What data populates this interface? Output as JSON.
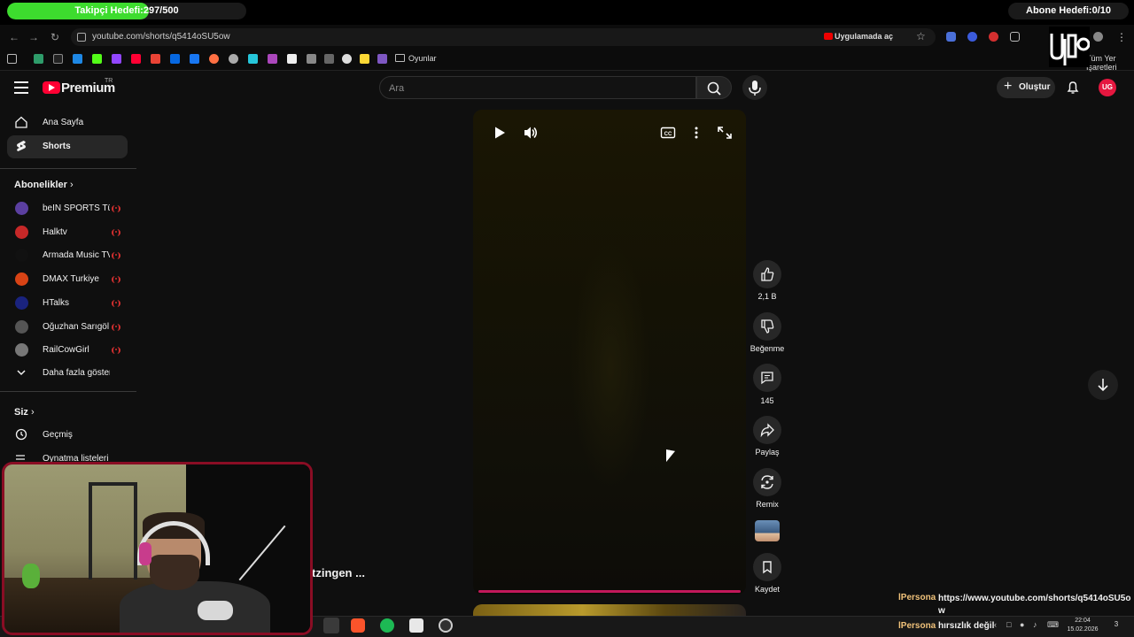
{
  "overlay": {
    "follower_goal": {
      "label": "Takipçi Hedefi:297/500",
      "progress": 0.594,
      "color": "#3ddc2e"
    },
    "sub_goal": {
      "label": "Abone Hedefi:0/10"
    }
  },
  "browser": {
    "url": "youtube.com/shorts/q5414oSU5ow",
    "open_in_app": "Uygulamada aç",
    "bookmark_folder": "Oyunlar",
    "other_bookmarks": "Tüm Yer İşaretleri",
    "nav_icons": [
      "back-icon",
      "forward-icon",
      "reload-icon"
    ]
  },
  "youtube": {
    "brand": "Premium",
    "region": "TR",
    "search_placeholder": "Ara",
    "create_label": "Oluştur",
    "avatar_initials": "UG"
  },
  "sidebar": {
    "home": "Ana Sayfa",
    "shorts": "Shorts",
    "subscriptions_heading": "Abonelikler",
    "subscriptions": [
      {
        "name": "beIN SPORTS Tü...",
        "avatar_color": "#5b3fa0",
        "live": true
      },
      {
        "name": "Halktv",
        "avatar_color": "#c62828",
        "live": true
      },
      {
        "name": "Armada Music TV",
        "avatar_color": "#111111",
        "live": true
      },
      {
        "name": "DMAX Turkiye",
        "avatar_color": "#d84315",
        "live": true
      },
      {
        "name": "HTalks",
        "avatar_color": "#1a237e",
        "live": true
      },
      {
        "name": "Oğuzhan Sarıgöl",
        "avatar_color": "#555555",
        "live": true
      },
      {
        "name": "RailCowGirl",
        "avatar_color": "#777777",
        "live": true
      }
    ],
    "show_more": "Daha fazla göster",
    "you_heading": "Siz",
    "history": "Geçmiş",
    "playlists": "Oynatma listeleri"
  },
  "short": {
    "title_fragment": "tzingen ...",
    "actions": {
      "likes": "2,1 B",
      "dislike": "Beğenme",
      "comments": "145",
      "share": "Paylaş",
      "remix": "Remix",
      "save": "Kaydet"
    },
    "progress_color": "#c2185b"
  },
  "chat": [
    {
      "name": "lPersona",
      "message": "https://www.youtube.com/shorts/q5414oSU5o w"
    },
    {
      "name": "lPersona",
      "message": "hırsızlık değil"
    }
  ],
  "taskbar": {
    "time": "22:04",
    "date": "15.02.2026",
    "notifications": "3"
  }
}
